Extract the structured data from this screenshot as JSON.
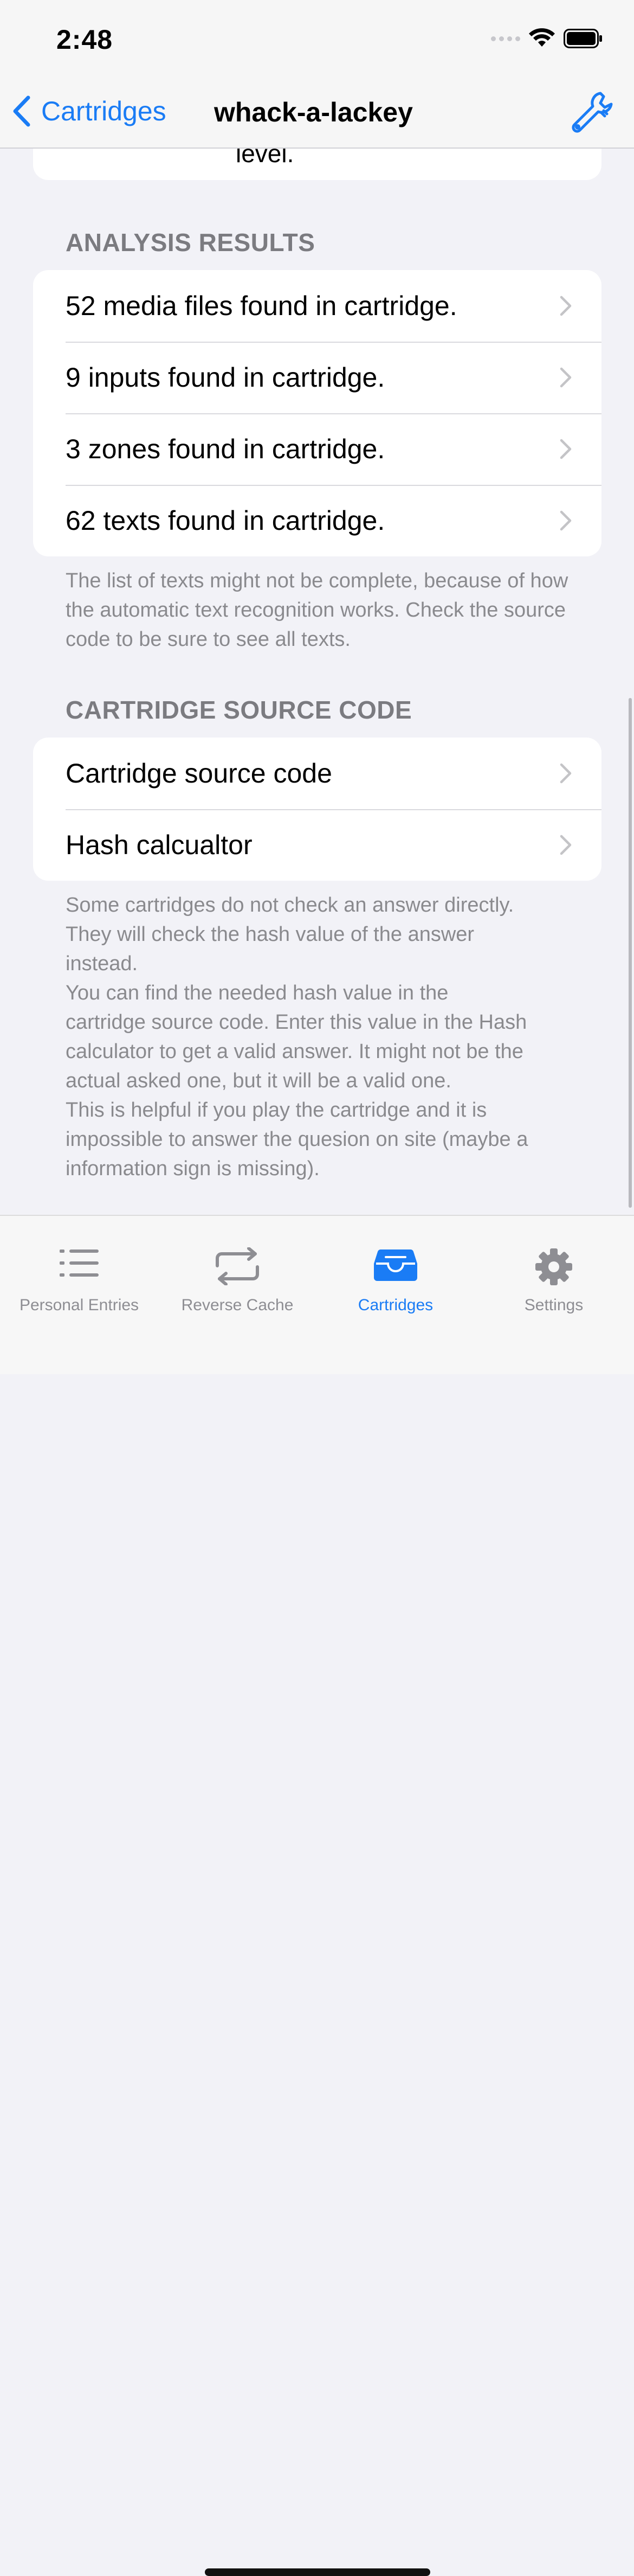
{
  "status_bar": {
    "time": "2:48"
  },
  "nav": {
    "back_label": "Cartridges",
    "title": "whack-a-lackey",
    "tool_icon": "wrench-icon"
  },
  "previous_section": {
    "trailing_text": "level."
  },
  "analysis": {
    "header": "ANALYSIS RESULTS",
    "rows": [
      {
        "label": "52 media files found in cartridge."
      },
      {
        "label": "9 inputs found in cartridge."
      },
      {
        "label": "3 zones found in cartridge."
      },
      {
        "label": "62 texts found in cartridge."
      }
    ],
    "footer": "The list of texts might not be complete, because of how the automatic text recognition works. Check the source code to be sure to see all texts."
  },
  "source": {
    "header": "CARTRIDGE SOURCE CODE",
    "rows": [
      {
        "label": "Cartridge source code"
      },
      {
        "label": "Hash calcualtor"
      }
    ],
    "footer_lines": [
      "Some cartridges do not check an answer directly.",
      "They will check the hash value of the answer",
      "instead.",
      "You can find the needed hash value in the",
      "cartridge source code. Enter this value in the Hash",
      "calculator to get a valid answer. It might not be the",
      "actual asked one, but it will be a valid one.",
      "This is helpful if you play the cartridge and it is",
      "impossible to answer the quesion on site (maybe a",
      "information sign is missing)."
    ]
  },
  "tabs": [
    {
      "label": "Personal Entries",
      "icon": "list-icon",
      "active": false
    },
    {
      "label": "Reverse Cache",
      "icon": "repeat-icon",
      "active": false
    },
    {
      "label": "Cartridges",
      "icon": "tray-icon",
      "active": true
    },
    {
      "label": "Settings",
      "icon": "gear-icon",
      "active": false
    }
  ],
  "colors": {
    "accent": "#1a7cf5",
    "secondary_text": "#8e8e93",
    "background": "#f2f2f7"
  }
}
